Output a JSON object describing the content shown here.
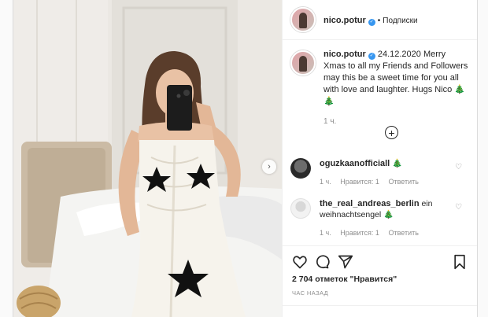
{
  "post": {
    "username": "nico.potur",
    "follow_label": "Подписки",
    "caption_date": "24.12.2020",
    "caption_text": "Merry Xmas to all my Friends and Followers may this be a sweet time for you all with love and laughter. Hugs Nico 🎄🎄",
    "caption_time": "1 ч.",
    "likes": "2 704 отметок \"Нравится\"",
    "time_ago": "ЧАС НАЗАД"
  },
  "comments": [
    {
      "username": "oguzkaanofficiall",
      "text": "🎄",
      "time": "1 ч.",
      "likes": "Нравится: 1",
      "reply": "Ответить"
    },
    {
      "username": "the_real_andreas_berlin",
      "text": "ein weihnachtsengel 🎄",
      "time": "1 ч.",
      "likes": "Нравится: 1",
      "reply": "Ответить"
    }
  ],
  "icons": {
    "verified": "verified-badge-icon",
    "more_comments": "plus-circle-icon",
    "like": "heart-icon",
    "comment": "comment-bubble-icon",
    "share": "paper-plane-icon",
    "save": "bookmark-icon",
    "next": "chevron-right-icon"
  }
}
